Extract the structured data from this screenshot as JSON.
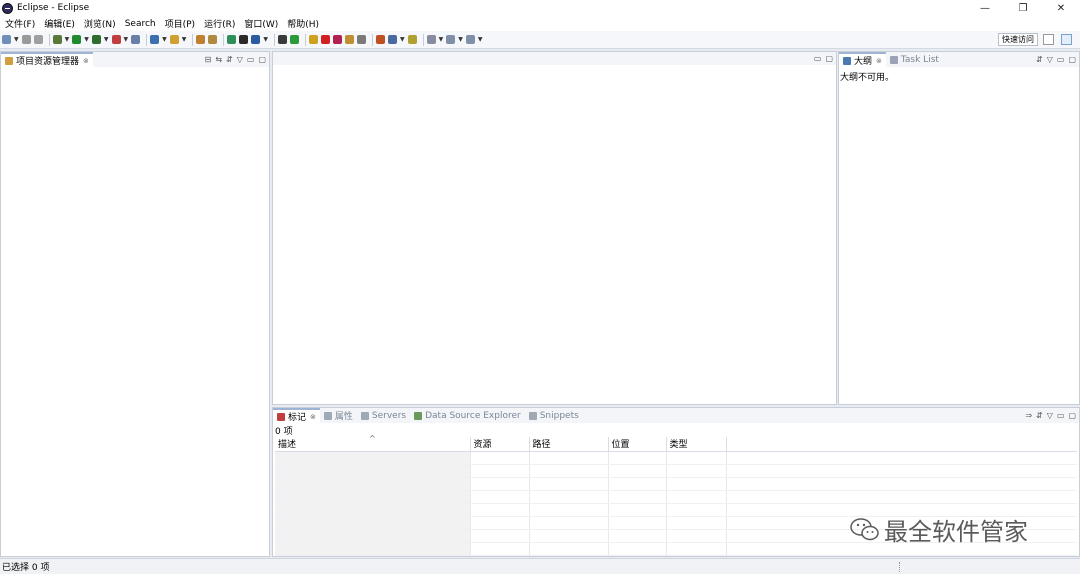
{
  "window": {
    "title": "Eclipse - Eclipse",
    "controls": [
      "—",
      "❐",
      "✕"
    ]
  },
  "menu": [
    "文件(F)",
    "编辑(E)",
    "浏览(N)",
    "Search",
    "项目(P)",
    "运行(R)",
    "窗口(W)",
    "帮助(H)"
  ],
  "toolbar": {
    "quick_access": "快速访问",
    "icon_colors": [
      "#6f8fb8",
      "#9a9a9a",
      "#a0a0a0",
      "#5a7a3a",
      "#1f8a2e",
      "#2f6d2f",
      "#c04040",
      "#6a7fa6",
      "#3a6fb0",
      "#d0a030",
      "#c08030",
      "#b08a40",
      "#2f8f5a",
      "#2a2a2a",
      "#2a5aa0",
      "#3a3a3a",
      "#2a9a3a",
      "#d0a020",
      "#d02020",
      "#b02050",
      "#c09030",
      "#7a7a7a",
      "#c05020",
      "#4a6aa0",
      "#b0a030",
      "#8a8aa0",
      "#8090a8",
      "#8090a8"
    ]
  },
  "project_explorer": {
    "tab_label": "项目资源管理器",
    "tab_close": "⊗",
    "tools": [
      "⊟",
      "⇆",
      "⇵",
      "▽",
      "▭",
      "▢"
    ]
  },
  "editor_area": {
    "tools": [
      "▭",
      "▢"
    ]
  },
  "outline": {
    "tab_label": "大纲",
    "tab_close": "⊗",
    "task_list_label": "Task List",
    "message": "大纲不可用。",
    "tools": [
      "⇵",
      "▽",
      "▭",
      "▢"
    ]
  },
  "bottom_panel": {
    "tabs": [
      {
        "label": "标记",
        "active": true,
        "color": "#c04040"
      },
      {
        "label": "属性",
        "active": false,
        "color": "#8a8a8a"
      },
      {
        "label": "Servers",
        "active": false,
        "color": "#8a8a8a"
      },
      {
        "label": "Data Source Explorer",
        "active": false,
        "color": "#5a8a4a"
      },
      {
        "label": "Snippets",
        "active": false,
        "color": "#8a8a8a"
      }
    ],
    "tab_close": "⊗",
    "count_text": "0 项",
    "sort_indicator": "^",
    "columns": [
      "描述",
      "资源",
      "路径",
      "位置",
      "类型"
    ],
    "tools": [
      "⇒",
      "⇵",
      "▽",
      "▭",
      "▢"
    ]
  },
  "status_bar": {
    "text": "已选择 0 项"
  },
  "watermark": {
    "text": "最全软件管家"
  }
}
